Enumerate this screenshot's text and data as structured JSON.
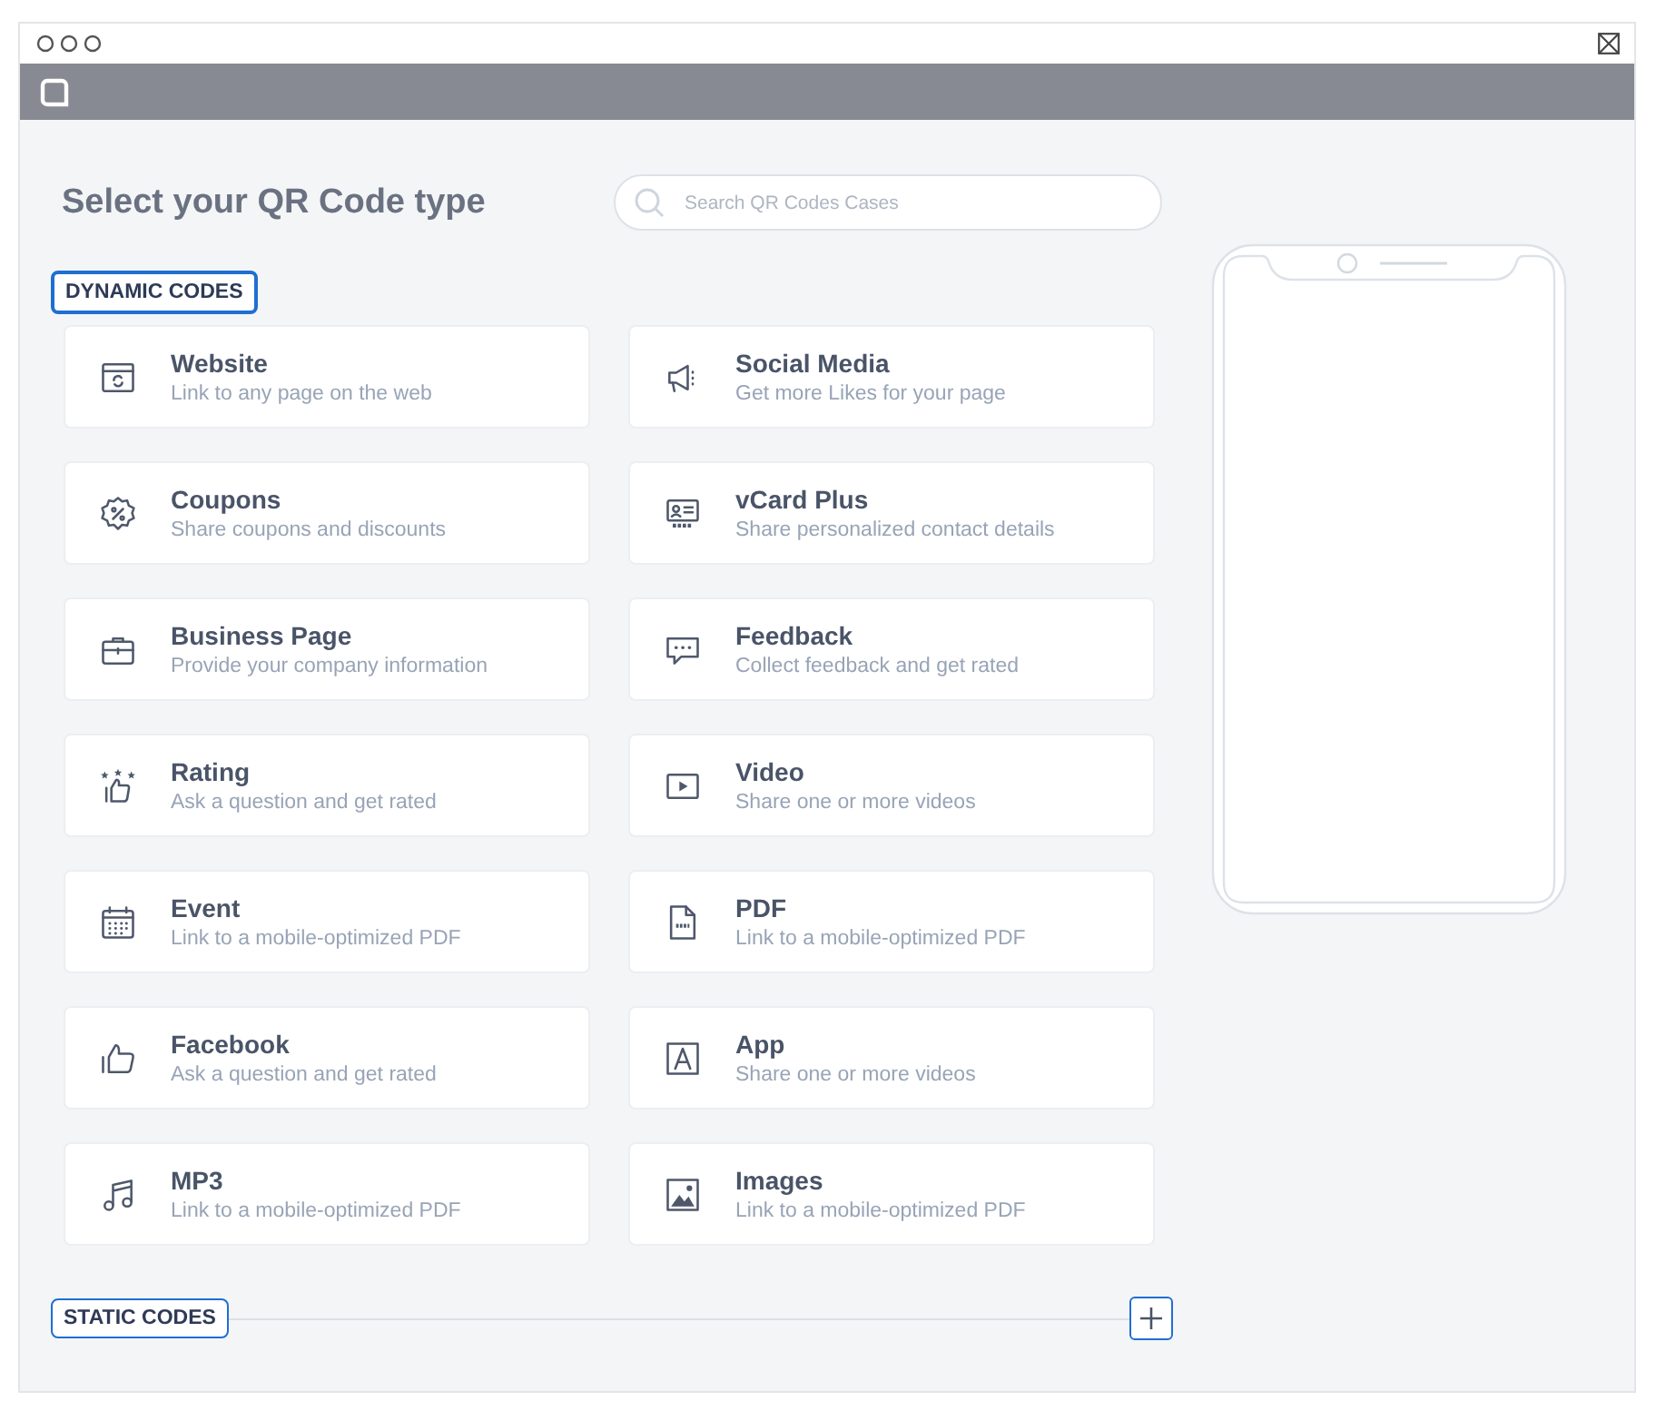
{
  "page": {
    "title": "Select your QR Code type"
  },
  "search": {
    "placeholder": "Search QR Codes Cases"
  },
  "sections": [
    {
      "label": "DYNAMIC CODES",
      "expanded": true,
      "items": [
        {
          "title": "Website",
          "description": "Link to any page on the web"
        },
        {
          "title": "Social Media",
          "description": "Get more Likes for your page"
        },
        {
          "title": "Coupons",
          "description": "Share coupons and discounts"
        },
        {
          "title": "vCard Plus",
          "description": "Share personalized contact details"
        },
        {
          "title": "Business Page",
          "description": "Provide your company information"
        },
        {
          "title": "Feedback",
          "description": "Collect feedback and get rated"
        },
        {
          "title": "Rating",
          "description": "Ask a question and get rated"
        },
        {
          "title": "Video",
          "description": "Share one or more videos"
        },
        {
          "title": "Event",
          "description": "Link to a mobile-optimized PDF"
        },
        {
          "title": "PDF",
          "description": "Link to a mobile-optimized PDF"
        },
        {
          "title": "Facebook",
          "description": "Ask a question and get rated"
        },
        {
          "title": "App",
          "description": "Share one or more videos"
        },
        {
          "title": "MP3",
          "description": "Link to a mobile-optimized PDF"
        },
        {
          "title": "Images",
          "description": "Link to a mobile-optimized PDF"
        }
      ]
    },
    {
      "label": "STATIC CODES",
      "expanded": false
    }
  ]
}
